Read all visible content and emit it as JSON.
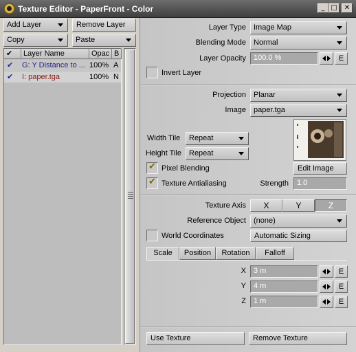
{
  "window": {
    "title": "Texture Editor - PaperFront - Color",
    "controls": [
      "_",
      "□",
      "✕"
    ]
  },
  "left": {
    "add_layer": "Add Layer",
    "remove_layer": "Remove Layer",
    "copy": "Copy",
    "paste": "Paste",
    "columns": {
      "check": "✔",
      "name": "Layer Name",
      "opac": "Opac",
      "blend": "B"
    },
    "layers": [
      {
        "check": "✔",
        "name": "G: Y Distance to ...",
        "opac": "100%",
        "blend": "A",
        "color": "#1f1f8a"
      },
      {
        "check": "✔",
        "name": "I: paper.tga",
        "opac": "100%",
        "blend": "N",
        "color": "#8a1a1a"
      }
    ]
  },
  "right": {
    "layer_type_label": "Layer Type",
    "layer_type": "Image Map",
    "blending_mode_label": "Blending Mode",
    "blending_mode": "Normal",
    "layer_opacity_label": "Layer Opacity",
    "layer_opacity": "100.0 %",
    "e": "E",
    "invert_layer": "Invert Layer",
    "projection_label": "Projection",
    "projection": "Planar",
    "image_label": "Image",
    "image": "paper.tga",
    "width_tile_label": "Width Tile",
    "width_tile": "Repeat",
    "height_tile_label": "Height Tile",
    "height_tile": "Repeat",
    "pixel_blending": "Pixel Blending",
    "edit_image": "Edit Image",
    "texture_antialiasing": "Texture Antialiasing",
    "strength_label": "Strength",
    "strength": "1.0",
    "texture_axis_label": "Texture Axis",
    "axis": [
      "X",
      "Y",
      "Z"
    ],
    "reference_object_label": "Reference Object",
    "reference_object": "(none)",
    "world_coordinates": "World Coordinates",
    "automatic_sizing": "Automatic Sizing",
    "tabs": [
      "Scale",
      "Position",
      "Rotation",
      "Falloff"
    ],
    "x_label": "X",
    "x_value": "3 m",
    "y_label": "Y",
    "y_value": "4 m",
    "z_label": "Z",
    "z_value": "1 m",
    "use_texture": "Use Texture",
    "remove_texture": "Remove Texture"
  },
  "colors": {
    "titlebar": "#4a4a4a",
    "panel": "#d4d0c8",
    "field": "#a9a9a9",
    "checkmark": "#7a6a00"
  }
}
